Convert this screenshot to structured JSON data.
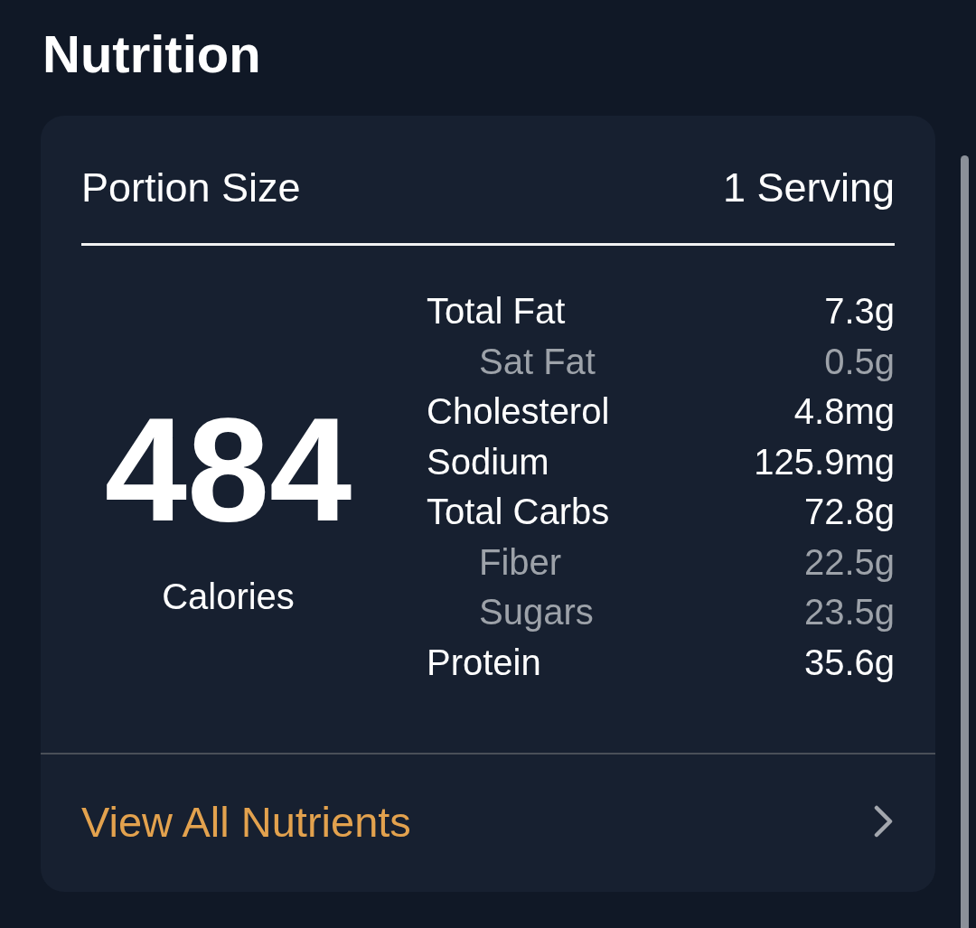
{
  "title": "Nutrition",
  "portion": {
    "label": "Portion Size",
    "value": "1 Serving"
  },
  "calories": {
    "value": "484",
    "label": "Calories"
  },
  "nutrients": [
    {
      "name": "Total Fat",
      "amount": "7.3g",
      "kind": "main"
    },
    {
      "name": "Sat Fat",
      "amount": "0.5g",
      "kind": "sub"
    },
    {
      "name": "Cholesterol",
      "amount": "4.8mg",
      "kind": "main"
    },
    {
      "name": "Sodium",
      "amount": "125.9mg",
      "kind": "main"
    },
    {
      "name": "Total Carbs",
      "amount": "72.8g",
      "kind": "main"
    },
    {
      "name": "Fiber",
      "amount": "22.5g",
      "kind": "sub"
    },
    {
      "name": "Sugars",
      "amount": "23.5g",
      "kind": "sub"
    },
    {
      "name": "Protein",
      "amount": "35.6g",
      "kind": "main"
    }
  ],
  "link": {
    "label": "View All Nutrients"
  }
}
